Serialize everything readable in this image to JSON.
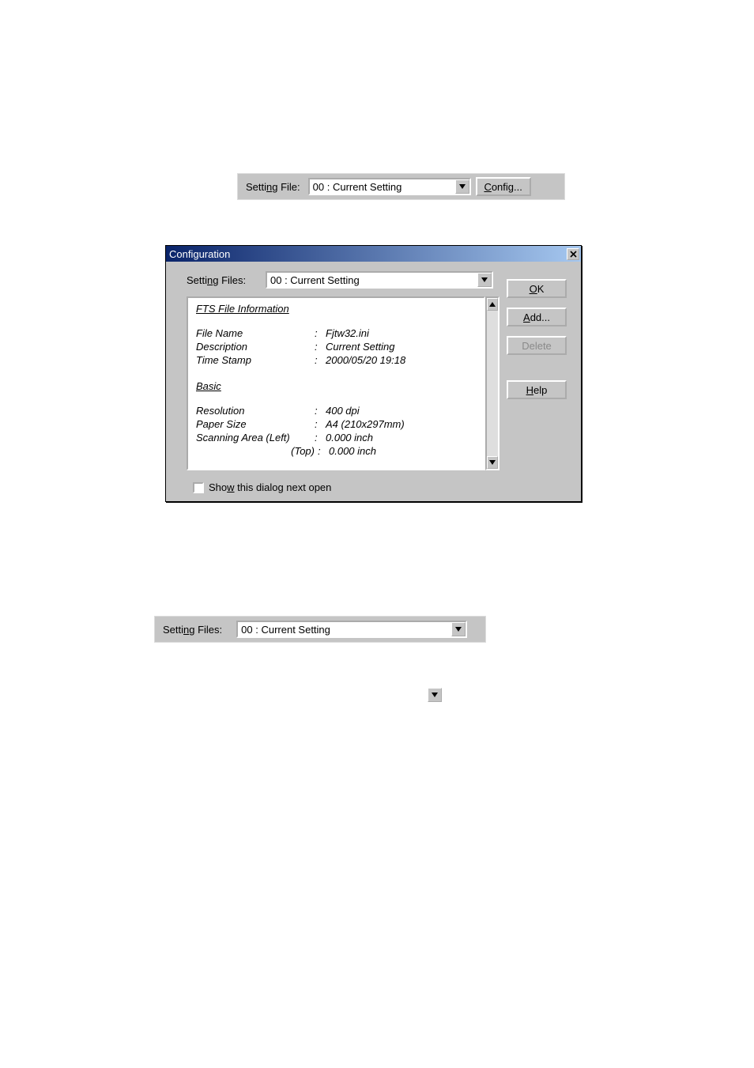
{
  "strip1": {
    "label": "Setting File:",
    "value": "00 : Current Setting",
    "config_label": "Config..."
  },
  "dialog": {
    "title": "Configuration",
    "label": "Setting Files:",
    "value": "00 : Current Setting",
    "buttons": {
      "ok": "OK",
      "add": "Add...",
      "delete": "Delete",
      "help": "Help"
    },
    "info": {
      "heading1": "FTS File Information",
      "file_name_k": "File Name",
      "file_name_v": "Fjtw32.ini",
      "description_k": "Description",
      "description_v": "Current Setting",
      "time_stamp_k": "Time Stamp",
      "time_stamp_v": "2000/05/20 19:18",
      "heading2": "Basic",
      "resolution_k": "Resolution",
      "resolution_v": "400 dpi",
      "paper_size_k": "Paper Size",
      "paper_size_v": "A4 (210x297mm)",
      "scan_left_k": "Scanning Area (Left)",
      "scan_left_v": "0.000 inch",
      "scan_top_k": "(Top)",
      "scan_top_v": "0.000 inch"
    },
    "colon": ":",
    "show_label": "Show this dialog next open"
  },
  "strip3": {
    "label": "Setting Files:",
    "value": "00 : Current Setting"
  }
}
